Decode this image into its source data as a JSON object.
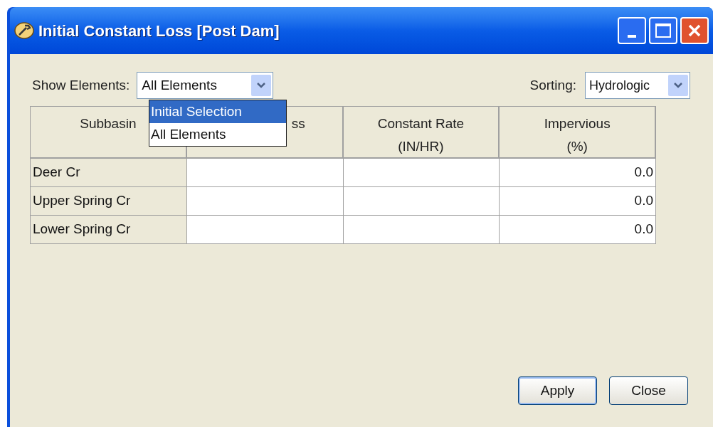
{
  "window": {
    "title": "Initial Constant Loss [Post Dam]"
  },
  "show_elements": {
    "label": "Show Elements:",
    "value": "All Elements",
    "expanded": true,
    "options": [
      {
        "label": "Initial Selection",
        "highlighted": true
      },
      {
        "label": "All Elements",
        "highlighted": false
      }
    ]
  },
  "sorting": {
    "label": "Sorting:",
    "value": "Hydrologic"
  },
  "table": {
    "columns": [
      {
        "lines": [
          "Subbasin"
        ]
      },
      {
        "lines": [
          "ss"
        ]
      },
      {
        "lines": [
          "Constant Rate",
          "(IN/HR)"
        ]
      },
      {
        "lines": [
          "Impervious",
          "(%)"
        ]
      }
    ],
    "rows": [
      [
        "Deer Cr",
        "",
        "",
        "0.0"
      ],
      [
        "Upper Spring Cr",
        "",
        "",
        "0.0"
      ],
      [
        "Lower Spring Cr",
        "",
        "",
        "0.0"
      ]
    ]
  },
  "buttons": [
    "Apply",
    "Close"
  ]
}
